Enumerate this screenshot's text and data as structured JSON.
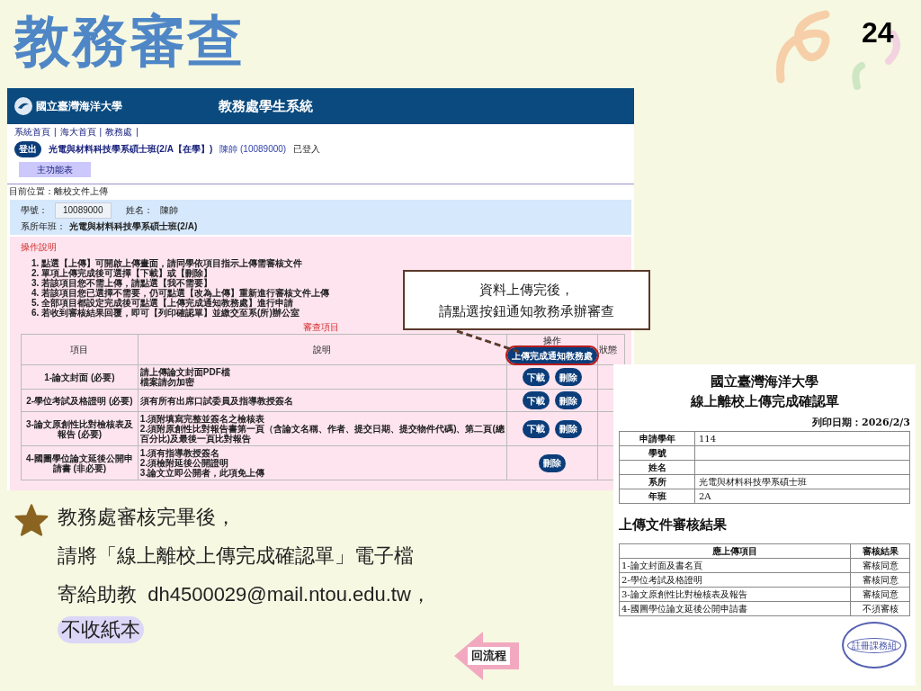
{
  "slide": {
    "title": "教務審查",
    "page_number": "24"
  },
  "screenshot": {
    "header": {
      "logo": "國立臺灣海洋大學",
      "title": "教務處學生系統"
    },
    "nav": {
      "links": [
        "系統首頁",
        "海大首頁",
        "教務處"
      ],
      "separator": "|"
    },
    "logout_button": "登出",
    "user_class": "光電與材料科技學系碩士班(2/A【在學】)",
    "user_name": "陳帥 (10089000)",
    "login_status": "已登入",
    "main_menu_button": "主功能表",
    "location": "目前位置：離校文件上傳",
    "student": {
      "id_label": "學號：",
      "id_value": "10089000",
      "name_label": "姓名：",
      "name_value": "陳帥",
      "department_label": "系所年班：",
      "department_value": "光電與材料科技學系碩士班(2/A)"
    },
    "instructions_title": "操作說明",
    "instructions": [
      "1. 點選【上傳】可開啟上傳畫面，請同學依項目指示上傳需審核文件",
      "2. 單項上傳完成後可選擇【下載】或【刪除】",
      "3. 若該項目您不需上傳，請點選【我不需要】",
      "4. 若該項目您已選擇不需要，仍可點選【改為上傳】重新進行審核文件上傳",
      "5. 全部項目都設定完成後可點選【上傳完成通知教務處】進行申請",
      "6. 若收到審核結果回覆，即可【列印確認單】並繳交至系(所)辦公室"
    ],
    "review_title": "審查項目",
    "table": {
      "columns": [
        "項目",
        "說明",
        "操作",
        "狀態"
      ],
      "notify_button": "上傳完成通知教務處",
      "rows": [
        {
          "item": "1-論文封面 (必要)",
          "description": [
            "請上傳論文封面PDF檔",
            "檔案請勿加密"
          ],
          "buttons": [
            "下載",
            "刪除"
          ]
        },
        {
          "item": "2-學位考試及格證明 (必要)",
          "description": [
            "須有所有出席口試委員及指導教授簽名"
          ],
          "buttons": [
            "下載",
            "刪除"
          ]
        },
        {
          "item": "3-論文原創性比對檢核表及報告 (必要)",
          "description": [
            "1.須附填寫完整並簽名之檢核表",
            "2.須附原創性比對報告書第一頁（含論文名稱、作者、提交日期、提交物件代碼)、第二頁(總百分比)及最後一頁比對報告"
          ],
          "buttons": [
            "下載",
            "刪除"
          ]
        },
        {
          "item": "4-國圖學位論文延後公開申請書 (非必要)",
          "description": [
            "1.須有指導教授簽名",
            "2.須檢附延後公開證明",
            "3.論文立即公開者，此項免上傳"
          ],
          "buttons": [
            "刪除"
          ]
        }
      ]
    }
  },
  "callout": {
    "lines": [
      "資料上傳完後，",
      "請點選按鈕通知教務承辦審查"
    ]
  },
  "note": {
    "lines": [
      "教務處審核完畢後，",
      "請將「線上離校上傳完成確認單」電子檔",
      "寄給助教  dh4500029@mail.ntou.edu.tw，"
    ],
    "highlight": "不收紙本"
  },
  "flow_button": "回流程",
  "document": {
    "title_lines": [
      "國立臺灣海洋大學",
      "線上離校上傳完成確認單"
    ],
    "print_date": "列印日期：2026/2/3",
    "info_rows": [
      {
        "label": "申請學年",
        "value": "114"
      },
      {
        "label": "學號"
      },
      {
        "label": "姓名"
      },
      {
        "label": "系所",
        "value": "光電與材料科技學系碩士班"
      },
      {
        "label": "年班",
        "value": "2A"
      }
    ],
    "results_title": "上傳文件審核結果",
    "results_columns": [
      "應上傳項目",
      "審核結果"
    ],
    "results_rows": [
      {
        "item": "1-論文封面及書名頁",
        "result": "審核同意"
      },
      {
        "item": "2-學位考試及格證明",
        "result": "審核同意"
      },
      {
        "item": "3-論文原創性比對檢核表及報告",
        "result": "審核同意"
      },
      {
        "item": "4-國圖學位論文延後公開申請書",
        "result": "不須審核"
      }
    ],
    "stamp": "註冊課務組"
  }
}
